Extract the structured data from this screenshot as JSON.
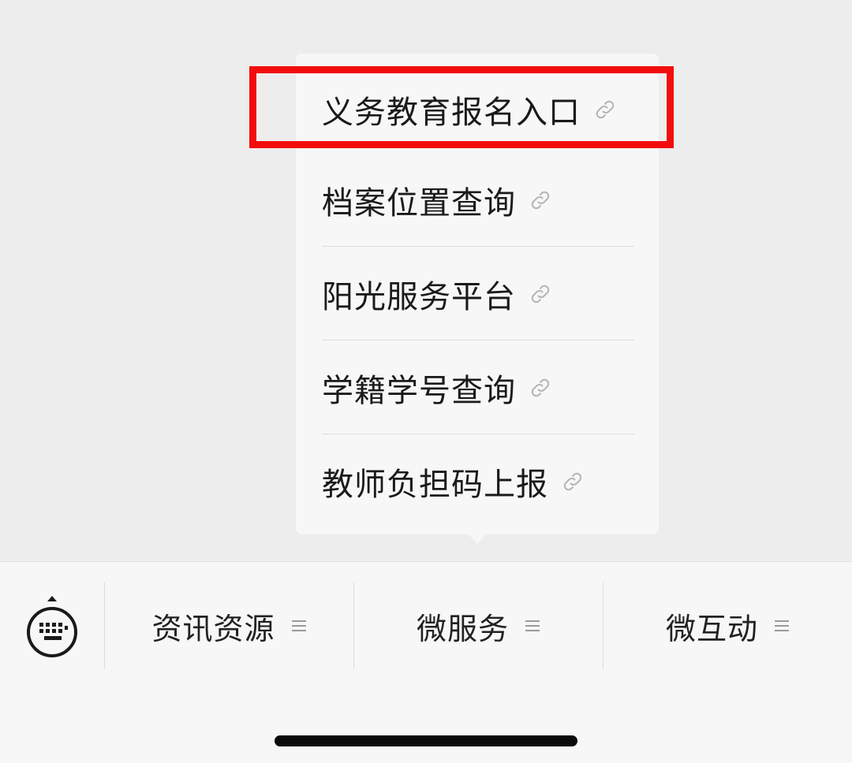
{
  "popup_menu": {
    "items": [
      {
        "label": "义务教育报名入口",
        "icon": "link-icon"
      },
      {
        "label": "档案位置查询",
        "icon": "link-icon"
      },
      {
        "label": "阳光服务平台",
        "icon": "link-icon"
      },
      {
        "label": "学籍学号查询",
        "icon": "link-icon"
      },
      {
        "label": "教师负担码上报",
        "icon": "link-icon"
      }
    ],
    "highlighted_index": 0,
    "highlight_color": "#f20d0d"
  },
  "bottom_bar": {
    "keyboard_icon": "keyboard-icon",
    "tabs": [
      {
        "label": "资讯资源",
        "icon": "menu-lines-icon"
      },
      {
        "label": "微服务",
        "icon": "menu-lines-icon"
      },
      {
        "label": "微互动",
        "icon": "menu-lines-icon"
      }
    ]
  },
  "colors": {
    "background": "#ededed",
    "menu_background": "#f7f7f7",
    "text": "#1a1a1a"
  }
}
